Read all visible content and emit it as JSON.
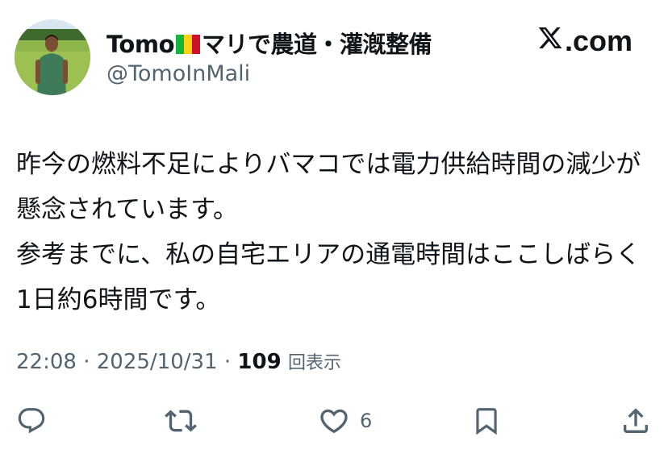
{
  "author": {
    "name_prefix": "Tomo",
    "name_suffix": "マリで農道・灌漑整備",
    "handle": "@TomoInMali"
  },
  "brand": {
    "label": ".com",
    "icon": "x-logo-icon"
  },
  "tweet": {
    "paragraphs": [
      "昨今の燃料不足によりバマコでは電力供給時間の減少が懸念されています。",
      "参考までに、私の自宅エリアの通電時間はここしばらく1日約6時間です。"
    ]
  },
  "meta": {
    "time": "22:08",
    "sep1": "·",
    "date": "2025/10/31",
    "sep2": "·",
    "views_count": "109",
    "views_label": "回表示"
  },
  "actions": {
    "reply": {
      "icon": "reply-icon"
    },
    "retweet": {
      "icon": "retweet-icon"
    },
    "like": {
      "icon": "heart-icon",
      "count": "6"
    },
    "bookmark": {
      "icon": "bookmark-icon"
    },
    "share": {
      "icon": "share-icon"
    }
  },
  "colors": {
    "text": "#0f1419",
    "secondary": "#536471",
    "flag_green": "#14b53a",
    "flag_yellow": "#fcd116",
    "flag_red": "#ce1126"
  }
}
